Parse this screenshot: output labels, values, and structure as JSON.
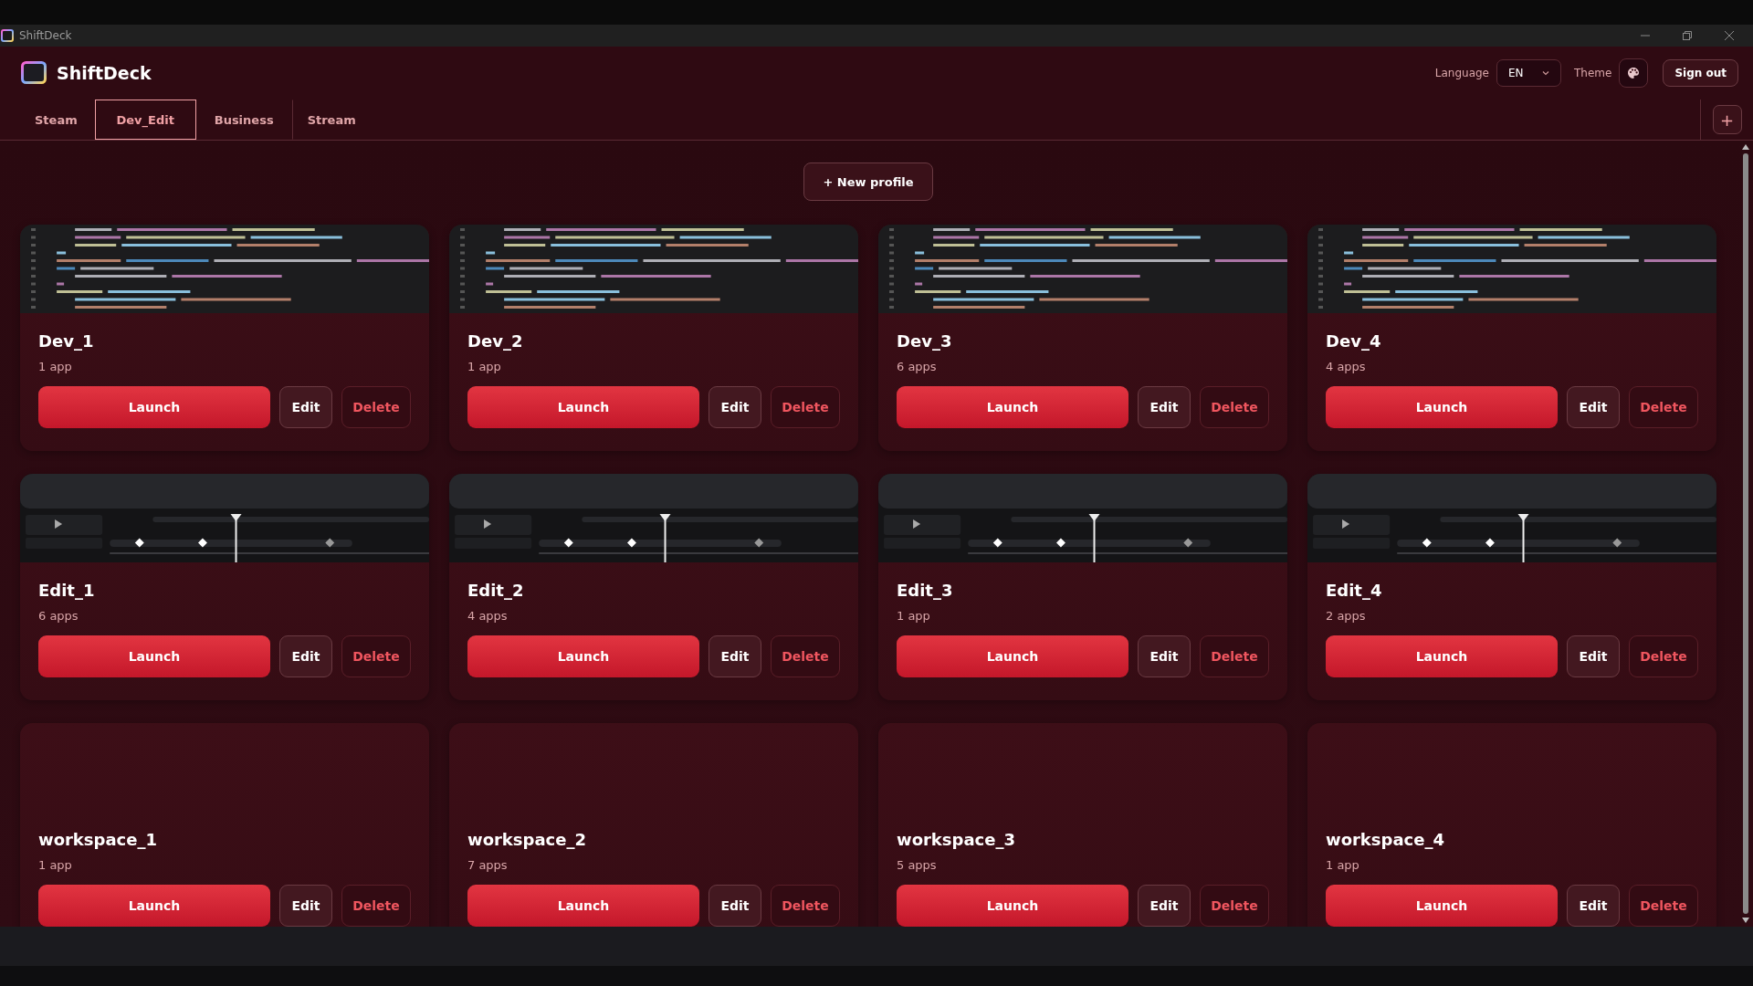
{
  "window": {
    "title": "ShiftDeck"
  },
  "app": {
    "name": "ShiftDeck"
  },
  "header": {
    "language_label": "Language",
    "language_value": "EN",
    "theme_label": "Theme",
    "sign_out": "Sign out"
  },
  "tabs": [
    {
      "label": "Steam",
      "selected": false
    },
    {
      "label": "Dev_Edit",
      "selected": true
    },
    {
      "label": "Business",
      "selected": false
    },
    {
      "label": "Stream",
      "selected": false
    }
  ],
  "add_tab": "+",
  "new_profile": "+ New profile",
  "profiles": [
    {
      "name": "Dev_1",
      "apps": "1 app",
      "launch": "Launch",
      "edit": "Edit",
      "delete": "Delete"
    },
    {
      "name": "Dev_2",
      "apps": "1 app",
      "launch": "Launch",
      "edit": "Edit",
      "delete": "Delete"
    },
    {
      "name": "Dev_3",
      "apps": "6 apps",
      "launch": "Launch",
      "edit": "Edit",
      "delete": "Delete"
    },
    {
      "name": "Dev_4",
      "apps": "4 apps",
      "launch": "Launch",
      "edit": "Edit",
      "delete": "Delete"
    },
    {
      "name": "Edit_1",
      "apps": "6 apps",
      "launch": "Launch",
      "edit": "Edit",
      "delete": "Delete"
    },
    {
      "name": "Edit_2",
      "apps": "4 apps",
      "launch": "Launch",
      "edit": "Edit",
      "delete": "Delete"
    },
    {
      "name": "Edit_3",
      "apps": "1 app",
      "launch": "Launch",
      "edit": "Edit",
      "delete": "Delete"
    },
    {
      "name": "Edit_4",
      "apps": "2 apps",
      "launch": "Launch",
      "edit": "Edit",
      "delete": "Delete"
    },
    {
      "name": "workspace_1",
      "apps": "1 app",
      "launch": "Launch",
      "edit": "Edit",
      "delete": "Delete"
    },
    {
      "name": "workspace_2",
      "apps": "7 apps",
      "launch": "Launch",
      "edit": "Edit",
      "delete": "Delete"
    },
    {
      "name": "workspace_3",
      "apps": "5 apps",
      "launch": "Launch",
      "edit": "Edit",
      "delete": "Delete"
    },
    {
      "name": "workspace_4",
      "apps": "1 app",
      "launch": "Launch",
      "edit": "Edit",
      "delete": "Delete"
    }
  ]
}
